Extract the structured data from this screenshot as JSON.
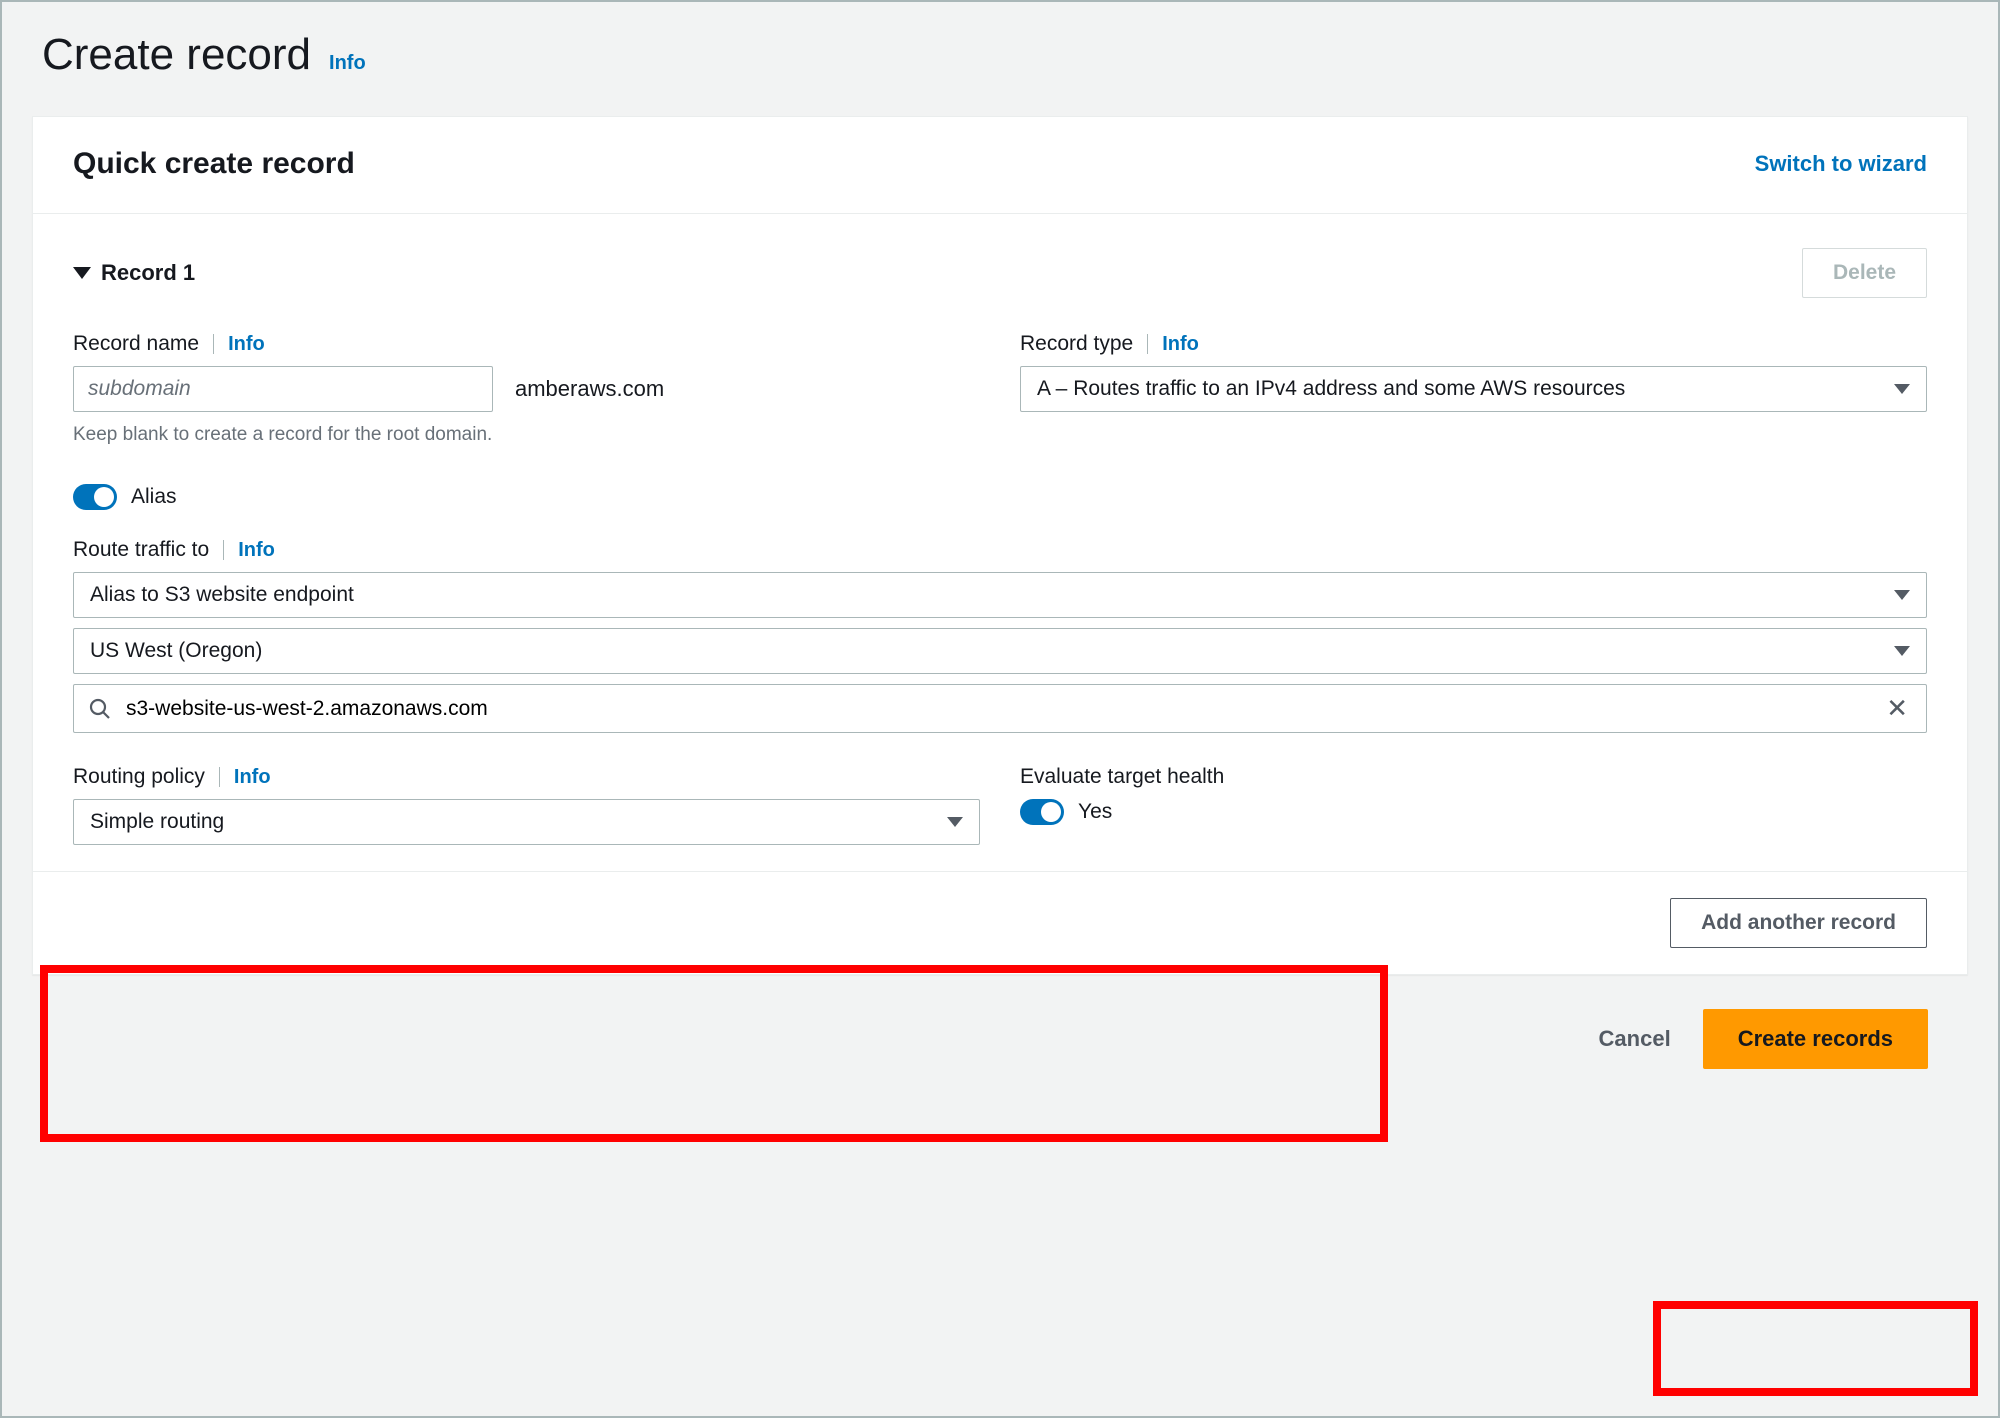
{
  "page": {
    "title": "Create record",
    "info_label": "Info"
  },
  "panel": {
    "heading": "Quick create record",
    "switch_link": "Switch to wizard"
  },
  "record": {
    "title": "Record 1",
    "delete_label": "Delete",
    "name": {
      "label": "Record name",
      "info": "Info",
      "placeholder": "subdomain",
      "suffix": "amberaws.com",
      "help": "Keep blank to create a record for the root domain."
    },
    "type": {
      "label": "Record type",
      "info": "Info",
      "value": "A – Routes traffic to an IPv4 address and some AWS resources"
    },
    "alias": {
      "label": "Alias",
      "enabled": true
    },
    "route": {
      "label": "Route traffic to",
      "info": "Info",
      "alias_target": "Alias to S3 website endpoint",
      "region": "US West (Oregon)",
      "endpoint": "s3-website-us-west-2.amazonaws.com"
    },
    "routing_policy": {
      "label": "Routing policy",
      "info": "Info",
      "value": "Simple routing"
    },
    "evaluate_health": {
      "label": "Evaluate target health",
      "value_label": "Yes",
      "enabled": true
    }
  },
  "footer": {
    "add_another": "Add another record",
    "cancel": "Cancel",
    "create": "Create records"
  }
}
